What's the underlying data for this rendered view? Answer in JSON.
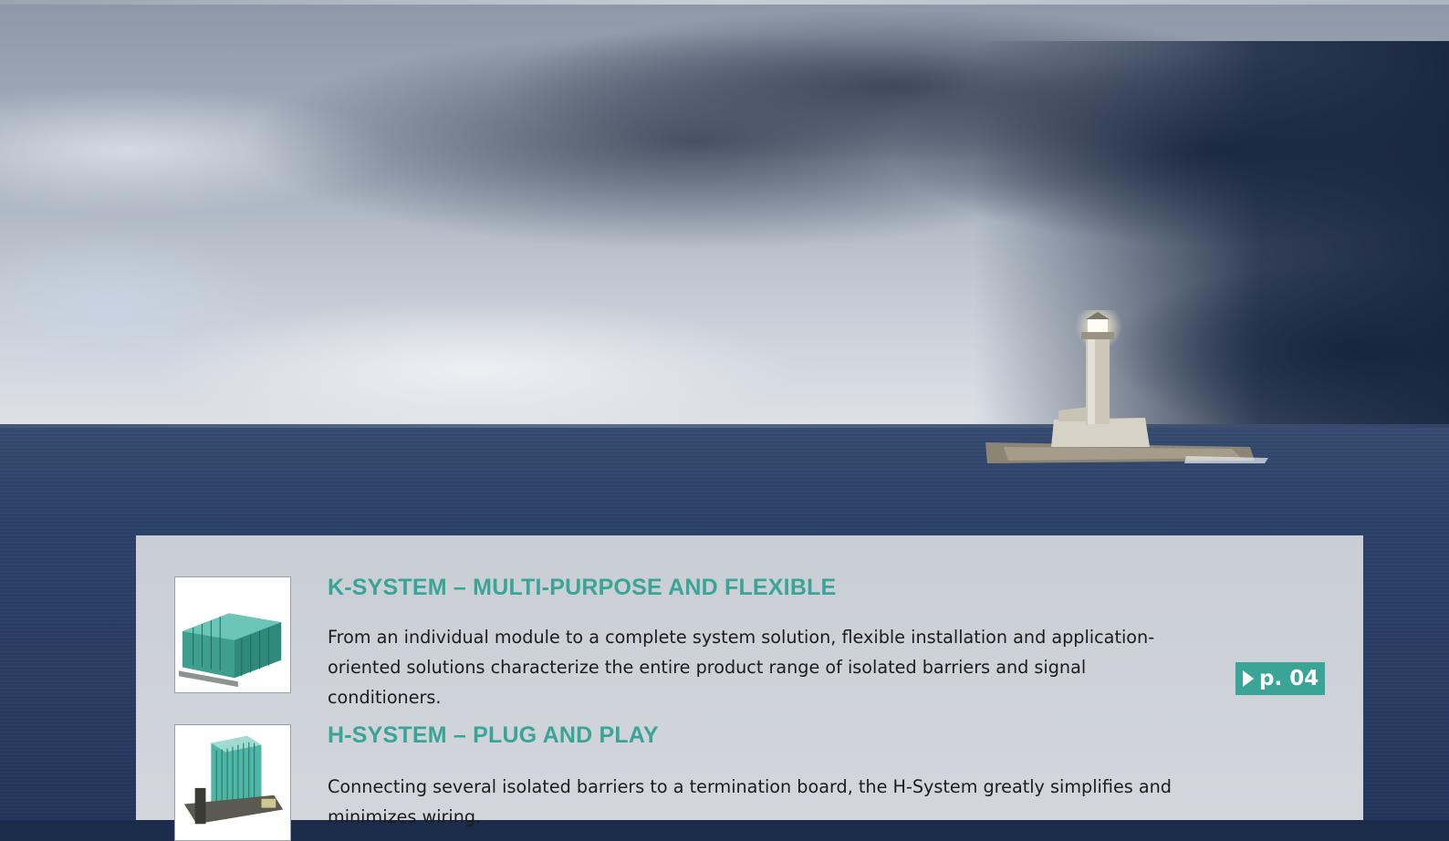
{
  "sections": [
    {
      "heading": "K-SYSTEM – MULTI-PURPOSE AND FLEXIBLE",
      "description": "From an individual module to a complete system solution, flexible installation and application-oriented solutions characterize the entire product range of isolated barriers and signal conditioners.",
      "page_ref": "p. 04",
      "image": "k-system-module-photo"
    },
    {
      "heading": "H-SYSTEM – PLUG AND PLAY",
      "description": "Connecting several isolated barriers to a termination board, the H-System greatly simplifies and minimizes wiring.",
      "page_ref": "",
      "image": "h-system-module-photo"
    }
  ],
  "hero_image": "lighthouse-at-sea-under-storm-clouds",
  "colors": {
    "accent": "#3aa597",
    "panel": "#d0d4d9",
    "text": "#1c1c1c"
  }
}
